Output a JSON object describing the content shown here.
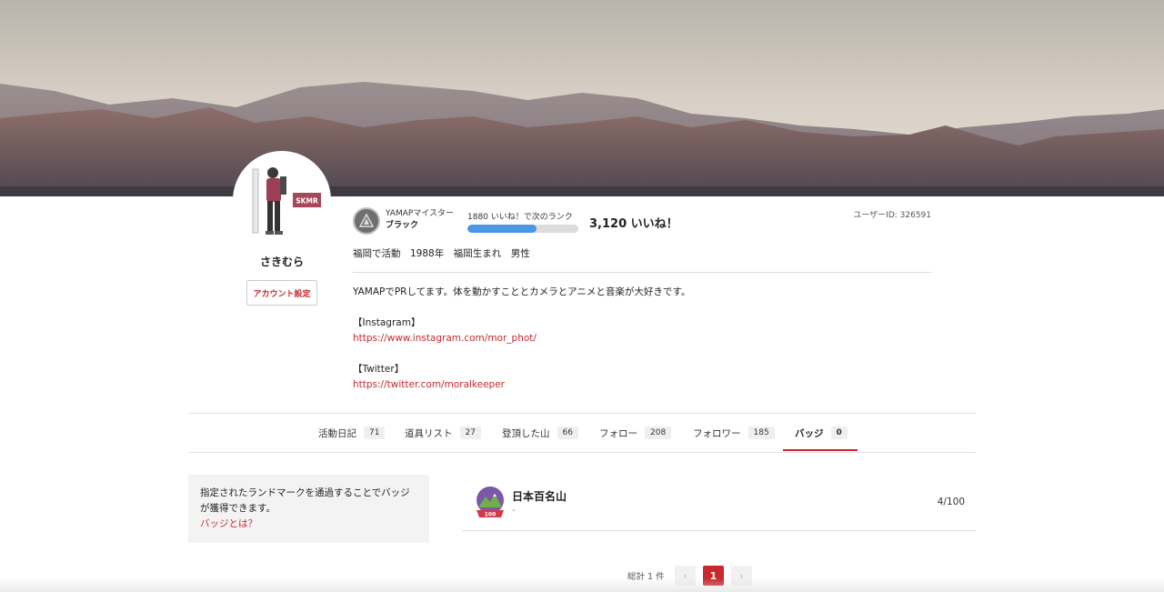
{
  "profile": {
    "name": "さきむら",
    "avatar_tag": "SKMR",
    "account_settings_label": "アカウント設定",
    "user_id": "ユーザーID: 326591",
    "meta": "福岡で活動　1988年　福岡生まれ　男性"
  },
  "rank": {
    "title": "YAMAPマイスター",
    "level": "ブラック",
    "next_rank_text": "1880 いいね！で次のランク",
    "progress_fraction": 0.62,
    "likes_total": "3,120 いいね！"
  },
  "bio": {
    "intro": "YAMAPでPRしてます。体を動かすこととカメラとアニメと音楽が大好きです。",
    "instagram_heading": "【Instagram】",
    "instagram_url": "https://www.instagram.com/mor_phot/",
    "twitter_heading": "【Twitter】",
    "twitter_url": "https://twitter.com/moralkeeper"
  },
  "tabs": [
    {
      "label": "活動日記",
      "count": "71"
    },
    {
      "label": "道具リスト",
      "count": "27"
    },
    {
      "label": "登頂した山",
      "count": "66"
    },
    {
      "label": "フォロー",
      "count": "208"
    },
    {
      "label": "フォロワー",
      "count": "185"
    },
    {
      "label": "バッジ",
      "count": "0"
    }
  ],
  "badge_info": {
    "text": "指定されたランドマークを通過することでバッジが獲得できます。",
    "link": "バッジとは？"
  },
  "badges": [
    {
      "name": "日本百名山",
      "sub": "-",
      "progress": "4/100",
      "emblem_text": "100"
    }
  ],
  "pagination": {
    "total": "総計 1 件",
    "prev": "‹",
    "current": "1",
    "next": "›"
  },
  "colors": {
    "accent": "#c8282e",
    "progress": "#4a97e4"
  }
}
